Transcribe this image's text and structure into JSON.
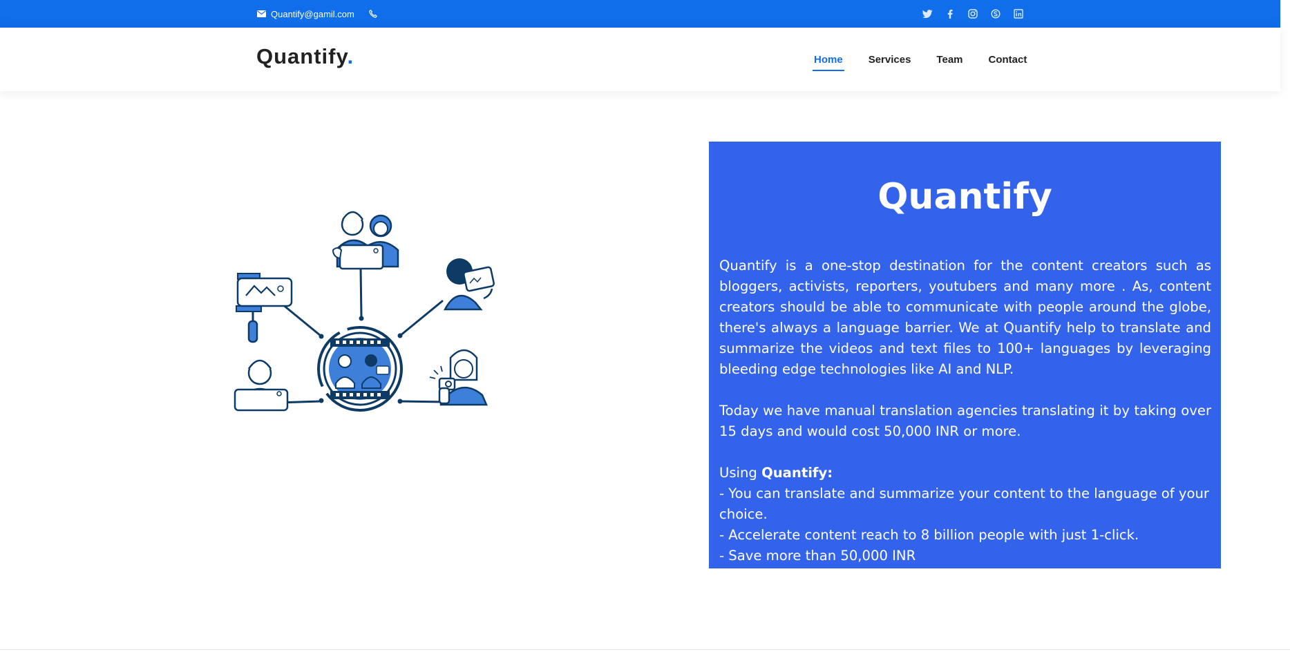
{
  "topbar": {
    "email": "Quantify@gamil.com",
    "social_icons": [
      "twitter-icon",
      "facebook-icon",
      "instagram-icon",
      "skype-icon",
      "linkedin-icon"
    ],
    "color": "#106eea"
  },
  "header": {
    "logo_text": "Quantify",
    "logo_dot": ".",
    "nav": [
      "Home",
      "Services",
      "Team",
      "Contact"
    ],
    "active_nav": "Home"
  },
  "main": {
    "illustration": "content-creators-network-illustration",
    "panel": {
      "title": "Quantify",
      "paragraph1": "Quantify is a one-stop destination for the content creators such as bloggers, activists, reporters, youtubers and many more . As, content creators should be able to communicate with people around the globe, there's always a language barrier. We at Quantify help to translate and summarize the videos and text files to 100+ languages by leveraging bleeding edge technologies like AI and NLP.",
      "paragraph2": "Today we have manual translation agencies translating it by taking over 15 days and would cost 50,000 INR or more.",
      "using_prefix": "Using ",
      "using_bold": "Quantify:",
      "bullets": [
        "- You can translate and summarize your content to the language of your choice.",
        "- Accelerate content reach to 8 billion people with just 1-click.",
        "- Save more than 50,000 INR"
      ],
      "color": "#3463eb"
    }
  }
}
